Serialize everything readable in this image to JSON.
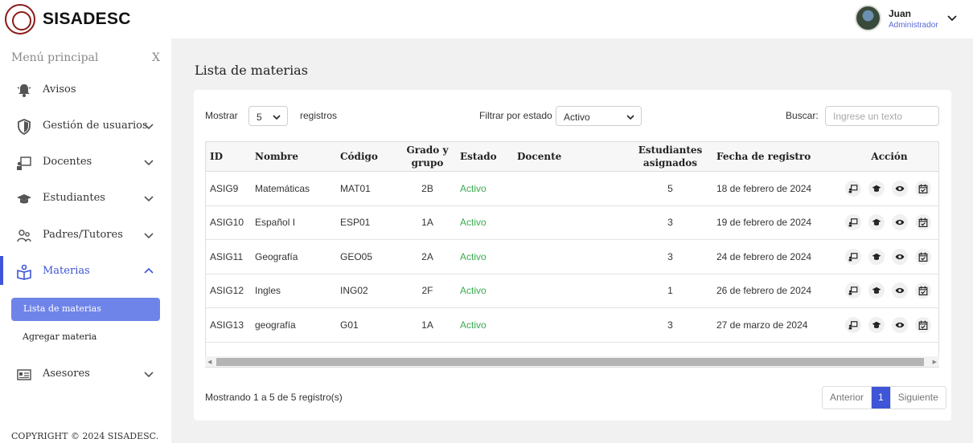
{
  "app": {
    "name": "SISADESC"
  },
  "user": {
    "name": "Juan",
    "role": "Administrador"
  },
  "sidebar": {
    "title": "Menú principal",
    "close": "X",
    "items": [
      {
        "label": "Avisos",
        "icon": "bell-icon"
      },
      {
        "label": "Gestión de usuarios",
        "icon": "shield-icon"
      },
      {
        "label": "Docentes",
        "icon": "teacher-icon"
      },
      {
        "label": "Estudiantes",
        "icon": "graduation-cap-icon"
      },
      {
        "label": "Padres/Tutores",
        "icon": "people-icon"
      },
      {
        "label": "Materias",
        "icon": "book-reader-icon"
      },
      {
        "label": "Asesores",
        "icon": "id-card-icon"
      }
    ],
    "subitems": [
      {
        "label": "Lista de materias",
        "active": true
      },
      {
        "label": "Agregar materia",
        "active": false
      }
    ],
    "copyright": "COPYRIGHT © 2024 SISADESC."
  },
  "page": {
    "title": "Lista de materias"
  },
  "controls": {
    "show_label": "Mostrar",
    "show_value": "5",
    "records_label": "registros",
    "filter_label": "Filtrar por estado",
    "filter_value": "Activo",
    "search_label": "Buscar:",
    "search_placeholder": "Ingrese un texto"
  },
  "table": {
    "headers": [
      "ID",
      "Nombre",
      "Código",
      "Grado y grupo",
      "Estado",
      "Docente",
      "Estudiantes asignados",
      "Fecha de registro",
      "Acción"
    ],
    "rows": [
      {
        "id": "ASIG9",
        "nombre": "Matemáticas",
        "codigo": "MAT01",
        "grado": "2B",
        "estado": "Activo",
        "docente": "",
        "estudiantes": "5",
        "fecha": "18 de febrero de 2024"
      },
      {
        "id": "ASIG10",
        "nombre": "Español I",
        "codigo": "ESP01",
        "grado": "1A",
        "estado": "Activo",
        "docente": "",
        "estudiantes": "3",
        "fecha": "19 de febrero de 2024"
      },
      {
        "id": "ASIG11",
        "nombre": "Geografía",
        "codigo": "GEO05",
        "grado": "2A",
        "estado": "Activo",
        "docente": "",
        "estudiantes": "3",
        "fecha": "24 de febrero de 2024"
      },
      {
        "id": "ASIG12",
        "nombre": "Ingles",
        "codigo": "ING02",
        "grado": "2F",
        "estado": "Activo",
        "docente": "",
        "estudiantes": "1",
        "fecha": "26 de febrero de 2024"
      },
      {
        "id": "ASIG13",
        "nombre": "geografía",
        "codigo": "G01",
        "grado": "1A",
        "estado": "Activo",
        "docente": "",
        "estudiantes": "3",
        "fecha": "27 de marzo de 2024"
      }
    ],
    "action_icons": [
      "assign-teacher-icon",
      "assign-students-icon",
      "view-icon",
      "calendar-icon"
    ]
  },
  "footer": {
    "info": "Mostrando 1 a 5 de 5 registro(s)",
    "prev": "Anterior",
    "page": "1",
    "next": "Siguiente"
  },
  "colors": {
    "accent": "#3d55d6",
    "active_status": "#3bab4f",
    "sub_active_bg": "#6f84e8"
  }
}
